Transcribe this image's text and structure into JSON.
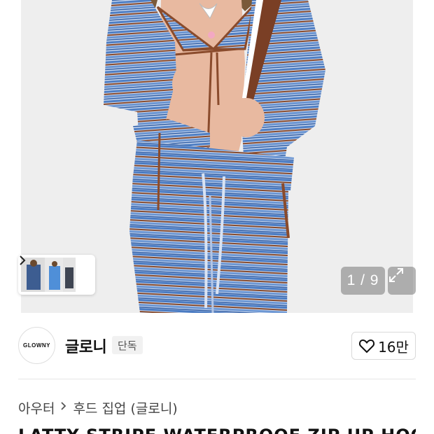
{
  "gallery": {
    "counter": "1 / 9",
    "expand_icon": "expand-icon",
    "next_icon": "chevron-right-icon"
  },
  "brand": {
    "logo_text": "GLOWNY",
    "name": "글로니",
    "badge": "단독",
    "like_count": "16만",
    "like_icon": "heart-outline-icon"
  },
  "breadcrumb": {
    "items": [
      "아우터",
      "후드 집업 (글로니)"
    ]
  },
  "product": {
    "title_partial": "LATTY STRIPE WATERPROOF ZIP UP HOODIE"
  },
  "colors": {
    "stripe_blue": "#4f7fc4",
    "stripe_light": "#c9d7ee",
    "stripe_brown": "#8a4b2c"
  }
}
